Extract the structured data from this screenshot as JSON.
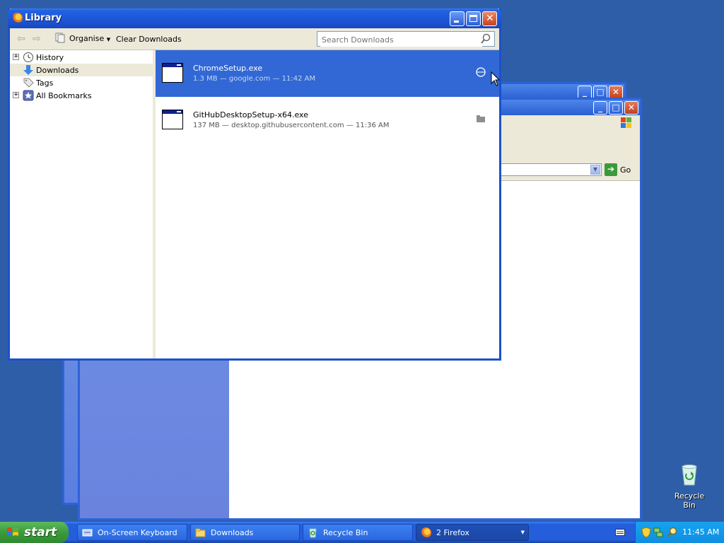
{
  "library": {
    "title": "Library",
    "toolbar": {
      "organise_label": "Organise",
      "clear_downloads_label": "Clear Downloads",
      "search_placeholder": "Search Downloads"
    },
    "sidebar": {
      "items": [
        {
          "label": "History",
          "expandable": true
        },
        {
          "label": "Downloads",
          "expandable": false,
          "selected": true
        },
        {
          "label": "Tags",
          "expandable": false
        },
        {
          "label": "All Bookmarks",
          "expandable": true
        }
      ]
    },
    "downloads": [
      {
        "name": "ChromeSetup.exe",
        "meta": "1.3 MB — google.com — 11:42 AM",
        "selected": true
      },
      {
        "name": "GitHubDesktopSetup-x64.exe",
        "meta": "137 MB — desktop.githubusercontent.com — 11:36 AM",
        "selected": false
      }
    ]
  },
  "background_window": {
    "go_label": "Go"
  },
  "desktop": {
    "recycle_bin_label": "Recycle Bin"
  },
  "taskbar": {
    "start_label": "start",
    "tasks": [
      {
        "label": "On-Screen Keyboard"
      },
      {
        "label": "Downloads"
      },
      {
        "label": "Recycle Bin"
      },
      {
        "label": "2 Firefox"
      }
    ],
    "clock": "11:45 AM"
  },
  "colors": {
    "desktop": "#2f5ea8",
    "selection": "#3168d5",
    "taskbar": "#245edb",
    "start": "#3b9a3b"
  }
}
